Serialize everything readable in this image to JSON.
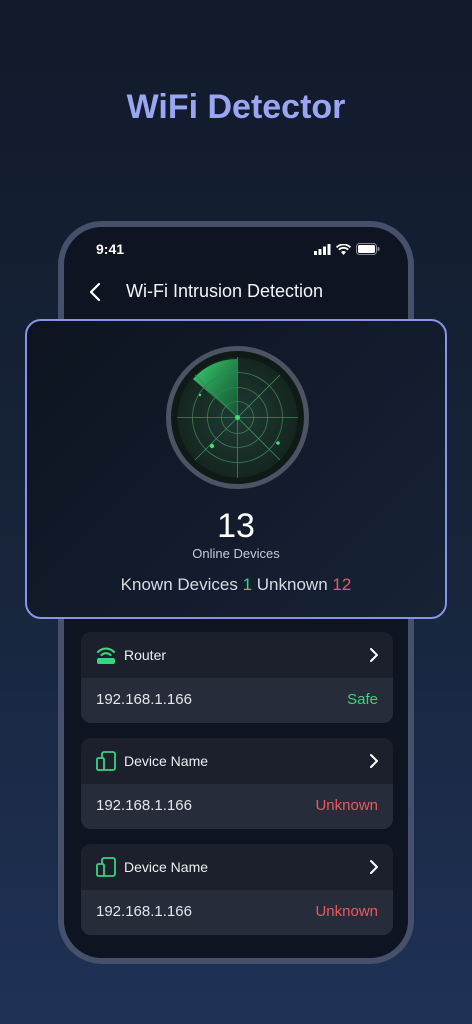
{
  "headline": "WiFi Detector",
  "status_bar": {
    "time": "9:41"
  },
  "nav": {
    "title": "Wi-Fi Intrusion Detection"
  },
  "scan": {
    "count": "13",
    "count_label": "Online Devices",
    "known_label": "Known Devices",
    "known_count": "1",
    "unknown_label": "Unknown",
    "unknown_count": "12"
  },
  "devices": [
    {
      "name": "Router",
      "ip": "192.168.1.166",
      "status": "Safe",
      "icon": "router-icon",
      "status_color": "#3bd37e"
    },
    {
      "name": "Device Name",
      "ip": "192.168.1.166",
      "status": "Unknown",
      "icon": "device-icon",
      "status_color": "#f0575c"
    },
    {
      "name": "Device Name",
      "ip": "192.168.1.166",
      "status": "Unknown",
      "icon": "device-icon",
      "status_color": "#f0575c"
    }
  ],
  "colors": {
    "accent": "#9aa6f2",
    "safe": "#3bd37e",
    "danger": "#f0575c"
  }
}
